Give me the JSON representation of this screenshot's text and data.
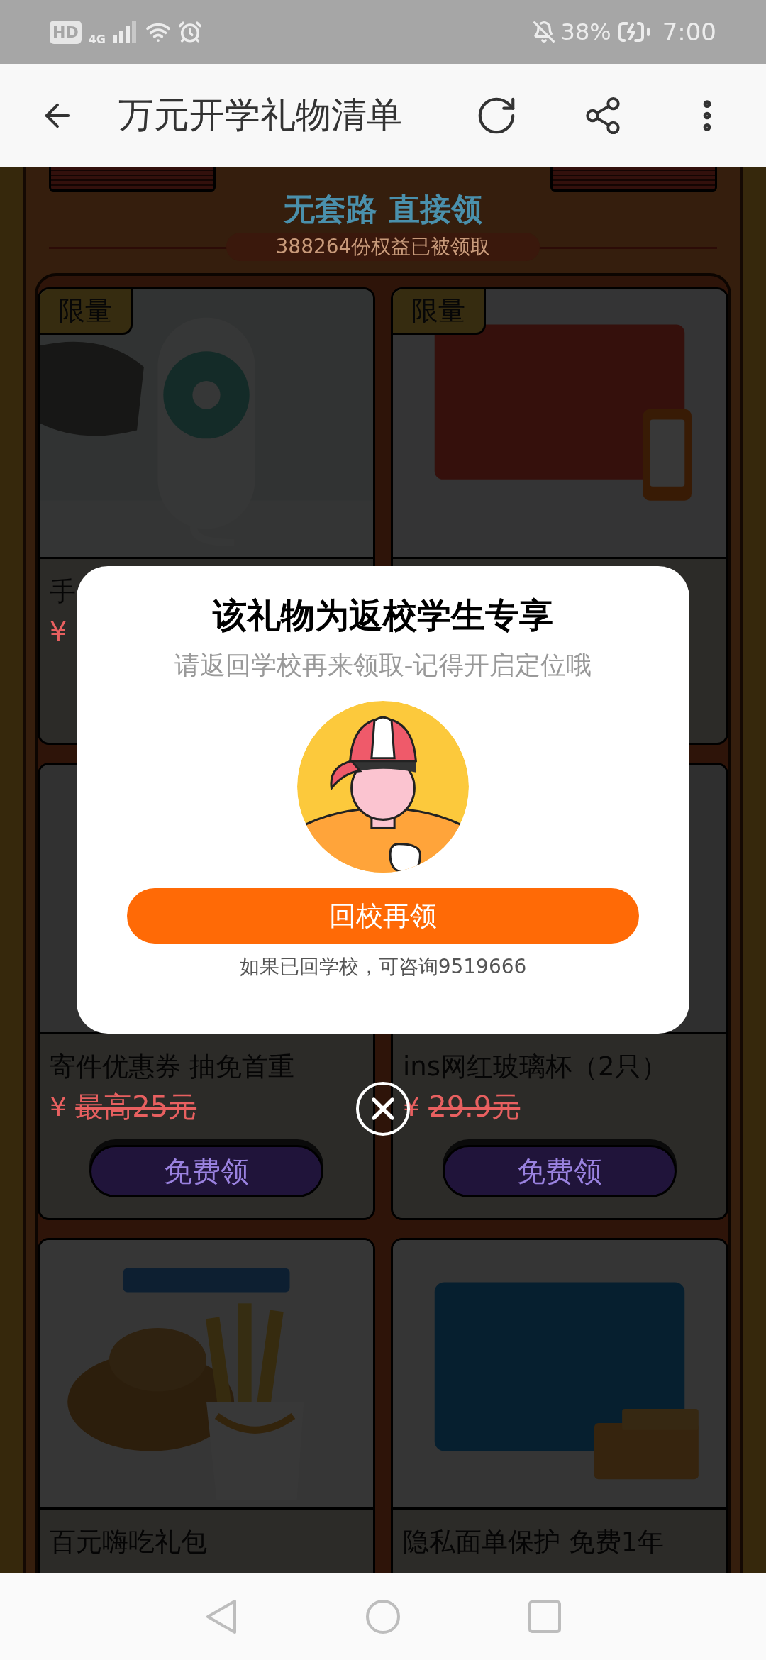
{
  "status_bar": {
    "badges": [
      "HD",
      "4G"
    ],
    "battery": "38%",
    "time": "7:00"
  },
  "header": {
    "title": "万元开学礼物清单"
  },
  "banner": {
    "slogan": "无套路 直接领",
    "claimed": "388264份权益已被领取"
  },
  "products": [
    {
      "badge": "限量",
      "title": "手",
      "currency": "¥"
    },
    {
      "badge": "限量"
    },
    {
      "title": "寄件优惠券 抽免首重",
      "currency": "¥",
      "price": "最高25元",
      "button": "免费领"
    },
    {
      "title": "ins网红玻璃杯（2只）",
      "currency": "¥",
      "price": "29.9元",
      "button": "免费领"
    },
    {
      "title": "百元嗨吃礼包"
    },
    {
      "title": "隐私面单保护 免费1年"
    }
  ],
  "dialog": {
    "title": "该礼物为返校学生专享",
    "subtitle": "请返回学校再来领取-记得开启定位哦",
    "button": "回校再领",
    "note": "如果已回学校，可咨询9519666"
  }
}
